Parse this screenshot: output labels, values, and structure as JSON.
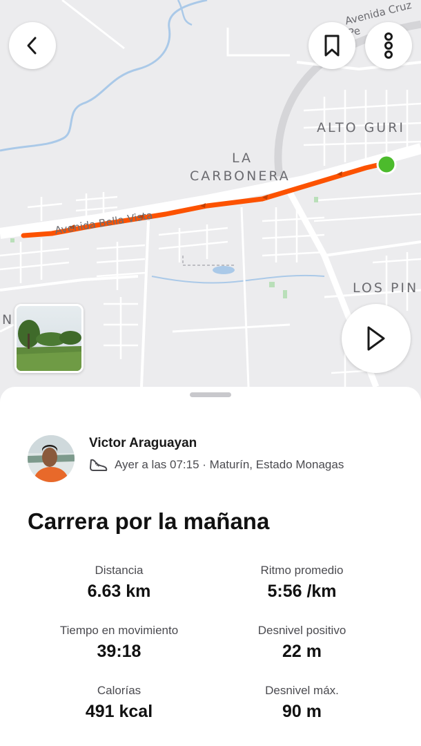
{
  "map": {
    "labels": {
      "street_top": "Avenida Cruz Pe",
      "alto_guri": "ALTO GURI",
      "la": "LA",
      "carbonera": "CARBONERA",
      "avenida": "Avenida Bella Vista",
      "los_pinos": "LOS PIN",
      "left_edge": "N"
    },
    "route_color": "#fc5200",
    "end_marker_color": "#4cbb2c"
  },
  "controls": {
    "back_icon": "chevron-left-icon",
    "bookmark_icon": "bookmark-icon",
    "more_icon": "more-vertical-icon",
    "play_icon": "play-icon"
  },
  "athlete": {
    "name": "Victor Araguayan",
    "meta": "Ayer a las 07:15 · Maturín, Estado Monagas",
    "activity_icon": "running-shoe-icon"
  },
  "activity": {
    "title": "Carrera por la mañana"
  },
  "stats": [
    {
      "label": "Distancia",
      "value": "6.63 km"
    },
    {
      "label": "Ritmo promedio",
      "value": "5:56 /km"
    },
    {
      "label": "Tiempo en movimiento",
      "value": "39:18"
    },
    {
      "label": "Desnivel positivo",
      "value": "22 m"
    },
    {
      "label": "Calorías",
      "value": "491 kcal"
    },
    {
      "label": "Desnivel máx.",
      "value": "90 m"
    }
  ]
}
